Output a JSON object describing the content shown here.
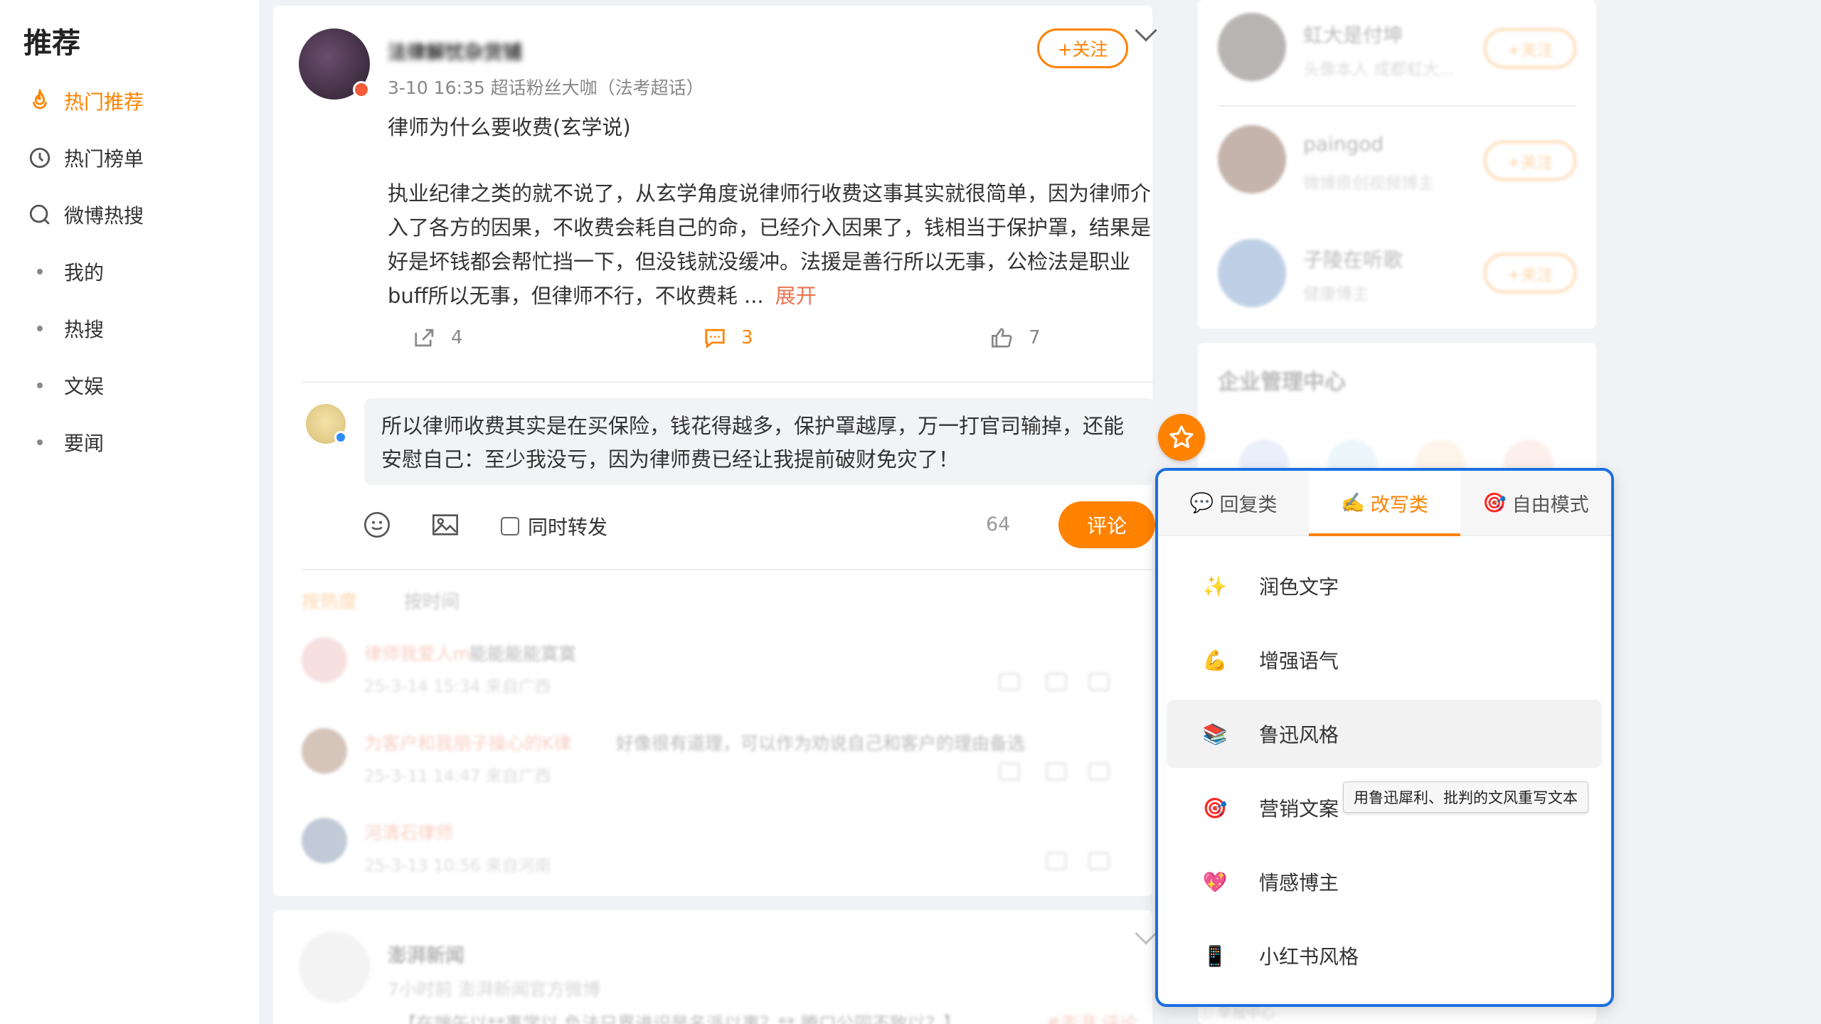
{
  "nav": {
    "title": "推荐",
    "items": [
      {
        "label": "热门推荐",
        "icon": "flame-icon",
        "active": true
      },
      {
        "label": "热门榜单",
        "icon": "clock-icon"
      },
      {
        "label": "微博热搜",
        "icon": "search-icon"
      },
      {
        "label": "我的"
      },
      {
        "label": "热搜"
      },
      {
        "label": "文娱"
      },
      {
        "label": "要闻"
      }
    ]
  },
  "post": {
    "author": "法律解忧杂货铺",
    "meta": "3-10 16:35  超话粉丝大咖（法考超话）",
    "follow_label": "+关注",
    "title": "律师为什么要收费(玄学说)",
    "body": "执业纪律之类的就不说了，从玄学角度说律师行收费这事其实就很简单，因为律师介入了各方的因果，不收费会耗自己的命，已经介入因果了，钱相当于保护罩，结果是好是坏钱都会帮忙挡一下，但没钱就没缓冲。法援是善行所以无事，公检法是职业buff所以无事，但律师不行，不收费耗 ...",
    "expand_label": "展开",
    "repost_count": "4",
    "comment_count": "3",
    "like_count": "7"
  },
  "reply": {
    "text": "所以律师收费其实是在买保险，钱花得越多，保护罩越厚，万一打官司输掉，还能安慰自己：至少我没亏，因为律师费已经让我提前破财免灾了！",
    "repost_label": "同时转发",
    "char_count": "64",
    "submit_label": "评论"
  },
  "comments": {
    "sort_hot": "按热度",
    "sort_time": "按时间",
    "rows": [
      {
        "name": "律师我爱人m",
        "text": "能能能能寞寞",
        "ts": "25-3-14 15:34 来自广西"
      },
      {
        "name": "为客户和我朋子操心的K律",
        "text": "好像很有道理，可以作为劝说自己和客户的理由备选",
        "ts": "25-3-11 14:47 来自广西"
      },
      {
        "name": "河清石律师",
        "text": "",
        "ts": "25-3-13 10:56 来自河南"
      }
    ]
  },
  "post2": {
    "author": "澎湃新闻",
    "meta": "7小时前  澎湃新闻官方微博",
    "text": "【在端午以**事学以 负法只界进识是名派以事？** 腾口公同不致以？】",
    "link": "#澎湃 评论"
  },
  "sidebar": {
    "suggestions": [
      {
        "name": "虹大是付坤",
        "desc": "头像本人 成都虹大...",
        "follow": "+关注"
      },
      {
        "name": "paingod",
        "desc": "微博原创视频博主",
        "follow": "+关注"
      },
      {
        "name": "子陵在听歌",
        "desc": "健康博主",
        "follow": "+关注"
      }
    ],
    "enterprise_title": "企业管理中心",
    "report_label": "举报中心"
  },
  "ai_popup": {
    "tabs": [
      {
        "label": "回复类",
        "icon": "💬",
        "active": false
      },
      {
        "label": "改写类",
        "icon": "✍️",
        "active": true
      },
      {
        "label": "自由模式",
        "icon": "🎯",
        "active": false
      }
    ],
    "items": [
      {
        "label": "润色文字",
        "icon": "✨"
      },
      {
        "label": "增强语气",
        "icon": "💪"
      },
      {
        "label": "鲁迅风格",
        "icon": "📚"
      },
      {
        "label": "营销文案",
        "icon": "🎯"
      },
      {
        "label": "情感博主",
        "icon": "💖"
      },
      {
        "label": "小红书风格",
        "icon": "📱"
      }
    ],
    "tooltip": "用鲁迅犀利、批判的文风重写文本"
  },
  "colors": {
    "accent": "#ff8200",
    "popup_border": "#1a6fe0",
    "link": "#eb7350"
  }
}
